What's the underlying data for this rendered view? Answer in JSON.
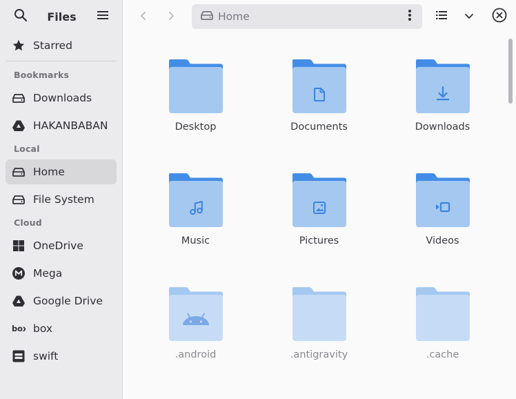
{
  "app": {
    "title": "Files"
  },
  "sidebar": {
    "starred": {
      "label": "Starred",
      "icon": "star-icon"
    },
    "sections": [
      {
        "heading": "Bookmarks",
        "items": [
          {
            "label": "Downloads",
            "icon": "drive-icon"
          },
          {
            "label": "HAKANBABAN",
            "icon": "google-drive-icon"
          }
        ]
      },
      {
        "heading": "Local",
        "items": [
          {
            "label": "Home",
            "icon": "drive-icon",
            "active": true
          },
          {
            "label": "File System",
            "icon": "drive-icon"
          }
        ]
      },
      {
        "heading": "Cloud",
        "items": [
          {
            "label": "OneDrive",
            "icon": "windows-icon"
          },
          {
            "label": "Mega",
            "icon": "mega-icon"
          },
          {
            "label": "Google Drive",
            "icon": "google-drive-icon"
          },
          {
            "label": "box",
            "icon": "box-icon"
          },
          {
            "label": "swift",
            "icon": "swift-icon"
          }
        ]
      }
    ]
  },
  "pathbar": {
    "location": "Home"
  },
  "files": [
    {
      "name": "Desktop",
      "emblem": "none",
      "hidden": false
    },
    {
      "name": "Documents",
      "emblem": "document",
      "hidden": false
    },
    {
      "name": "Downloads",
      "emblem": "download",
      "hidden": false
    },
    {
      "name": "Music",
      "emblem": "music",
      "hidden": false
    },
    {
      "name": "Pictures",
      "emblem": "picture",
      "hidden": false
    },
    {
      "name": "Videos",
      "emblem": "video",
      "hidden": false
    },
    {
      "name": ".android",
      "emblem": "android",
      "hidden": true
    },
    {
      "name": ".antigravity",
      "emblem": "none",
      "hidden": true
    },
    {
      "name": ".cache",
      "emblem": "none",
      "hidden": true
    }
  ],
  "colors": {
    "folder_back": "#438de6",
    "folder_front": "#a4c8f0",
    "folder_back_hidden": "#a4c8f0",
    "folder_front_hidden": "#c6dcf6",
    "emblem": "#3b84e0",
    "emblem_hidden": "#7aa9e6"
  }
}
